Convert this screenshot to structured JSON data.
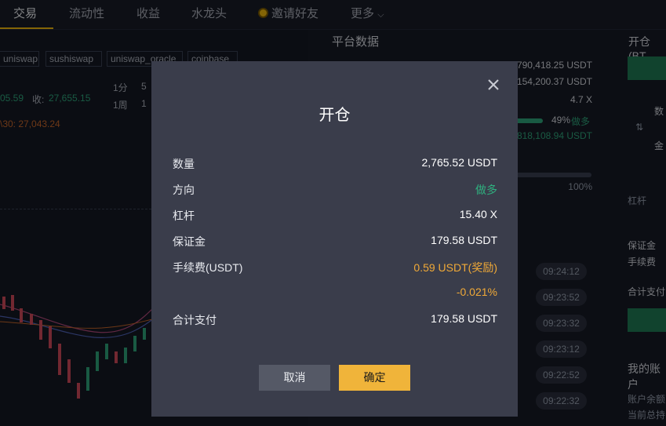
{
  "nav": {
    "items": [
      "交易",
      "流动性",
      "收益",
      "水龙头",
      "邀请好友",
      "更多"
    ],
    "more_chevron": "⌵"
  },
  "chart_header": {
    "tags": [
      "uniswap",
      "sushiswap",
      "uniswap_oracle",
      "coinbase"
    ],
    "price_partial": "05.59",
    "close_label": "收:",
    "close_value": "27,655.15",
    "ma_text": "\\30: 27,043.24",
    "interval_1m": "1分",
    "interval_5m_partial": "5",
    "interval_1w": "1周",
    "interval_month_partial": "1"
  },
  "platform": {
    "title": "平台数据",
    "v1": "790,418.25 USDT",
    "v2": "154,200.37 USDT",
    "v3": "4.7 X",
    "pct": "49%",
    "pct_label": "做多",
    "v4": "818,108.94 USDT",
    "pct2": "100%"
  },
  "times": [
    "09:24:12",
    "09:23:52",
    "09:23:32",
    "09:23:12",
    "09:22:52",
    "09:22:32"
  ],
  "right": {
    "title": "开仓(BT",
    "lbl1": "数",
    "lbl2": "金",
    "leverage": "杠杆",
    "margin": "保证金",
    "fee": "手续费",
    "total": "合计支付",
    "account": "我的账户",
    "balance": "账户余额",
    "current": "当前总持"
  },
  "modal": {
    "title": "开仓",
    "rows": [
      {
        "label": "数量",
        "value": "2,765.52 USDT"
      },
      {
        "label": "方向",
        "value": "做多"
      },
      {
        "label": "杠杆",
        "value": "15.40 X"
      },
      {
        "label": "保证金",
        "value": "179.58 USDT"
      },
      {
        "label": "手续费(USDT)",
        "value": "0.59 USDT(奖励)"
      },
      {
        "label": "",
        "value": "-0.021%"
      },
      {
        "label": "合计支付",
        "value": "179.58 USDT"
      }
    ],
    "cancel": "取消",
    "confirm": "确定"
  }
}
